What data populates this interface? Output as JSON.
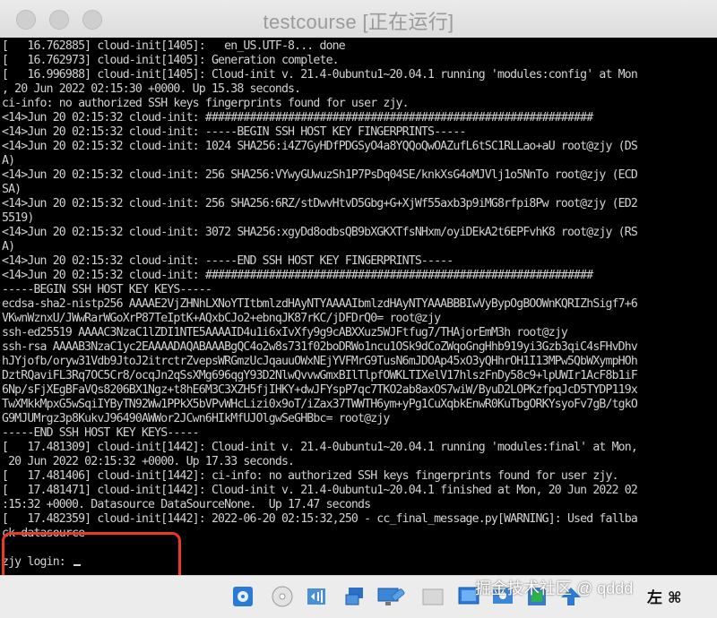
{
  "window": {
    "title": "testcourse [正在运行]"
  },
  "console": {
    "lines": [
      "[   16.762885] cloud-init[1405]:   en_US.UTF-8... done",
      "[   16.762973] cloud-init[1405]: Generation complete.",
      "[   16.996988] cloud-init[1405]: Cloud-init v. 21.4-0ubuntu1~20.04.1 running 'modules:config' at Mon",
      ", 20 Jun 2022 02:15:30 +0000. Up 15.38 seconds.",
      "ci-info: no authorized SSH keys fingerprints found for user zjy.",
      "<14>Jun 20 02:15:32 cloud-init: #############################################################",
      "<14>Jun 20 02:15:32 cloud-init: -----BEGIN SSH HOST KEY FINGERPRINTS-----",
      "<14>Jun 20 02:15:32 cloud-init: 1024 SHA256:i4Z7GyHDfPDGSyO4a8YQQoQwOAZufL6tSC1RLLao+aU root@zjy (DS",
      "A)",
      "<14>Jun 20 02:15:32 cloud-init: 256 SHA256:VYwyGUwuzSh1P7PsDq04SE/knkXsG4oMJVlj1o5NnTo root@zjy (ECD",
      "SA)",
      "<14>Jun 20 02:15:32 cloud-init: 256 SHA256:6RZ/stDwvHtvD5Gbg+G+XjWf55axb3p9iMG8rfpi8Pw root@zjy (ED2",
      "5519)",
      "<14>Jun 20 02:15:32 cloud-init: 3072 SHA256:xgyDd8odbsQB9bXGKXTfsNHxm/oyiDEkA2t6EPFvhK8 root@zjy (RS",
      "A)",
      "<14>Jun 20 02:15:32 cloud-init: -----END SSH HOST KEY FINGERPRINTS-----",
      "<14>Jun 20 02:15:32 cloud-init: #############################################################",
      "-----BEGIN SSH HOST KEY KEYS-----",
      "ecdsa-sha2-nistp256 AAAAE2VjZHNhLXNoYTItbmlzdHAyNTYAAAAIbmlzdHAyNTYAAABBBIwVyBypOgBOOWnKQRIZhSigf7+6",
      "VKwnWznxU/JWwRarWGoXrP87TeIptK+AQxbCJo2+ebnqJK87rKC/jDFDrQ0= root@zjy",
      "ssh-ed25519 AAAAC3NzaC1lZDI1NTE5AAAAID4u1i6xIvXfy9g9cABXXuz5WJFtfug7/THAjorEmM3h root@zjy",
      "ssh-rsa AAAAB3NzaC1yc2EAAAADAQABAAABgQC4o2w8s731f02boDRWo1ncu1OSk9dCoZWqoGngHhb919yi3Gzb3qiC4sFHvDhv",
      "hJYjofb/oryw31Vdb9JtoJ2itrctrZvepsWRGmzUcJqauuOWxNEjYVFMrG9TusN6mJDOAp45xO3yQHhrOH1I13MPw5QbWXympHOh",
      "DztRQaviFL3Rq7OC5Cr8/ocqJn2qSsXMg696qgY93D2NlwQvvwGmxBIlTlpfOWKLTIXelV17hlszFnDy58c9+lpUWIr1AcF8b1iF",
      "6Np/sFjXEgBFaVQs8206BX1Ngz+t8hE6M3C3XZH5fjIHKY+dwJFYspP7qc7TKO2ab8axOS7wiW/ByuD2LOPKzfpqJcD5TYDP119x",
      "TwXMkkMpxG5wSqiIYByTN92Ww1PPkX5bVPvWHcLizi0x9oT/iZax37TWWTH6ym+yPg1CuXqbkEnwR0KuTbgORKYsyoFv7gB/tgkO",
      "G9MJUMrgz3p8KukvJ96490AWWor2JCwn6HIkMfUJOlgwSeGHBbc= root@zjy",
      "-----END SSH HOST KEY KEYS-----",
      "[   17.481309] cloud-init[1442]: Cloud-init v. 21.4-0ubuntu1~20.04.1 running 'modules:final' at Mon,",
      " 20 Jun 2022 02:15:32 +0000. Up 17.33 seconds.",
      "[   17.481406] cloud-init[1442]: ci-info: no authorized SSH keys fingerprints found for user zjy.",
      "[   17.481471] cloud-init[1442]: Cloud-init v. 21.4-0ubuntu1~20.04.1 finished at Mon, 20 Jun 2022 02",
      ":15:32 +0000. Datasource DataSourceNone.  Up 17.47 seconds",
      "[   17.482359] cloud-init[1442]: 2022-06-20 02:15:32,250 - cc_final_message.py[WARNING]: Used fallba",
      "ck datasource",
      ""
    ],
    "login_prompt": "zjy login: "
  },
  "statusbar": {
    "icons": [
      "disk-icon",
      "optical-drive-icon",
      "audio-icon",
      "network-icon",
      "display-icon",
      "usb-icon",
      "shared-folder-icon",
      "screen-icon",
      "recording-icon",
      "cpu-icon",
      "arrow-icon"
    ],
    "host_key_label": "左 ⌘",
    "watermark": "掘金技术社区 @ qddd"
  },
  "colors": {
    "console_bg": "#000000",
    "console_fg": "#d2d2d2",
    "annotation": "#e8392a"
  }
}
